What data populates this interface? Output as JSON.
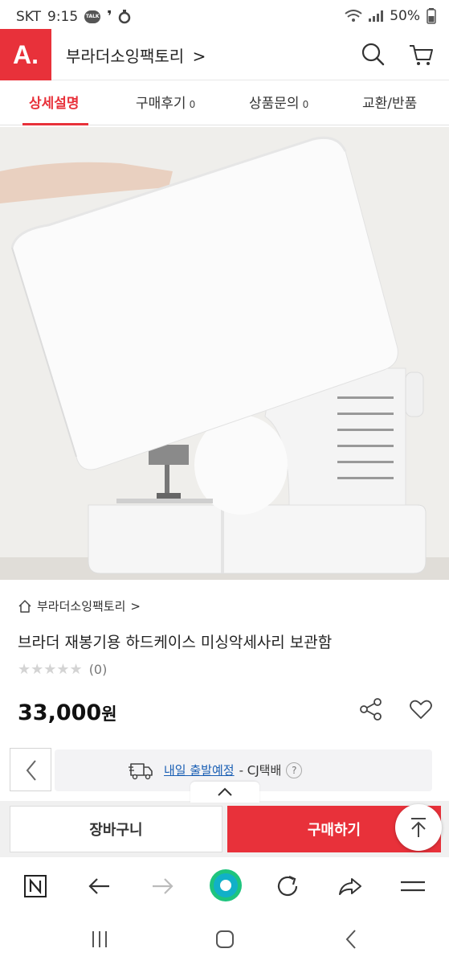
{
  "status_bar": {
    "carrier": "SKT",
    "time": "9:15",
    "talk_badge": "TALK",
    "battery": "50%"
  },
  "header": {
    "logo": "A.",
    "store_name": "부라더소잉팩토리",
    "store_chevron": ">"
  },
  "tabs": [
    {
      "label": "상세설명",
      "count": ""
    },
    {
      "label": "구매후기",
      "count": "0"
    },
    {
      "label": "상품문의",
      "count": "0"
    },
    {
      "label": "교환/반품",
      "count": ""
    }
  ],
  "product": {
    "breadcrumb": "부라더소잉팩토리",
    "breadcrumb_chevron": ">",
    "title": "브라더 재봉기용 하드케이스 미싱악세사리 보관함",
    "stars": "★★★★★",
    "review_count": "(0)",
    "price_number": "33,000",
    "price_unit": "원"
  },
  "shipping": {
    "highlight": "내일 출발예정",
    "carrier": "- CJ택배",
    "help": "?"
  },
  "actions": {
    "cart": "장바구니",
    "buy": "구매하기"
  },
  "colors": {
    "brand": "#e8313a",
    "link": "#1a5fb4"
  },
  "icons": {
    "header": [
      "search-icon",
      "cart-icon"
    ],
    "product": [
      "home-icon",
      "share-icon",
      "heart-icon"
    ],
    "browser": [
      "naver-n-icon",
      "back-arrow-icon",
      "forward-arrow-icon",
      "home-dot-icon",
      "reload-icon",
      "share-arrow-icon",
      "menu-icon"
    ],
    "system": [
      "recent-apps-icon",
      "home-icon",
      "back-icon"
    ]
  }
}
